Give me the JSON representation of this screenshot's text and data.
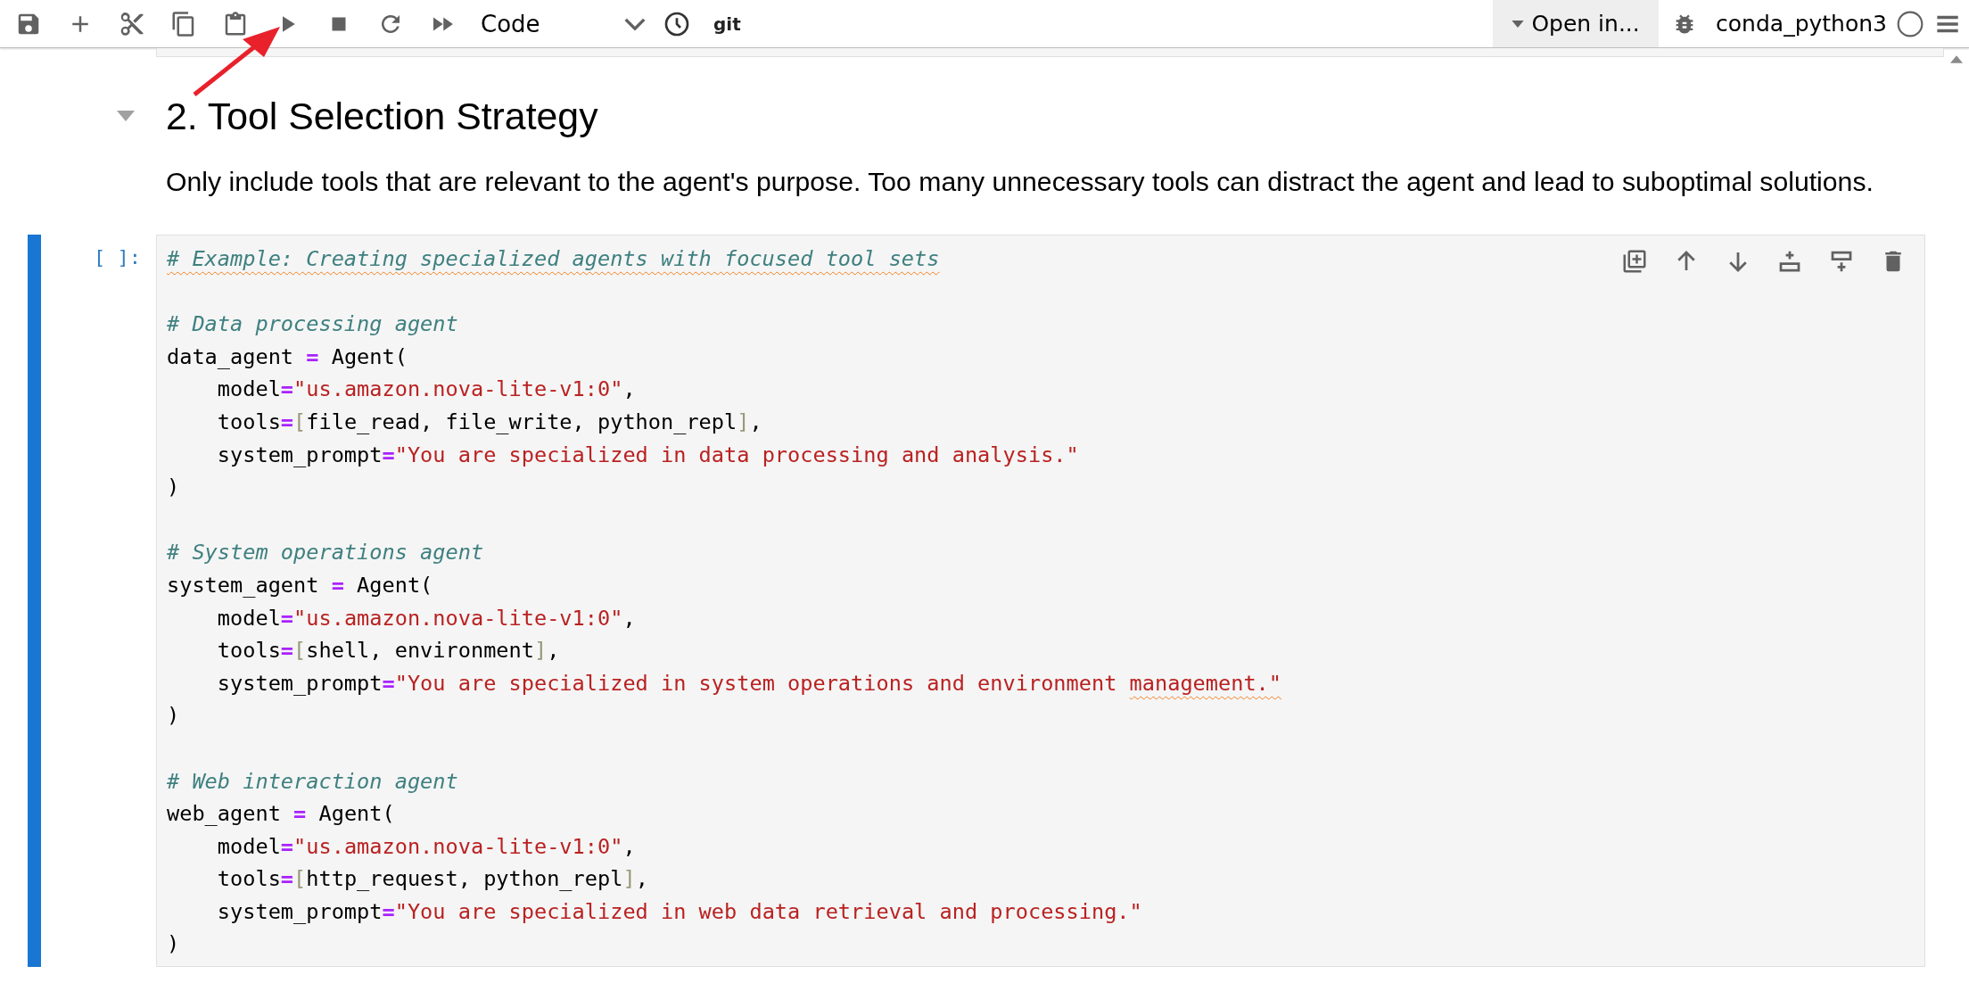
{
  "toolbar": {
    "cell_type": "Code",
    "git": "git",
    "open_in": "Open in...",
    "kernel": "conda_python3"
  },
  "section": {
    "expanded": true,
    "heading": "2. Tool Selection Strategy",
    "text": "Only include tools that are relevant to the agent's purpose. Too many unnecessary tools can distract the agent and lead to suboptimal solutions."
  },
  "cell": {
    "prompt": "[ ]:",
    "selected": true,
    "blocks": [
      {
        "lines": [
          {
            "tokens": [
              {
                "kind": "comment",
                "text": "# Example: Creating specialized agents with focused tool sets",
                "spellcheck": true
              }
            ]
          }
        ]
      },
      {
        "lines": [
          {
            "tokens": [
              {
                "kind": "comment",
                "text": "# Data processing agent"
              }
            ]
          },
          {
            "tokens": [
              {
                "kind": "plain",
                "text": "data_agent "
              },
              {
                "kind": "op",
                "text": "="
              },
              {
                "kind": "plain",
                "text": " Agent("
              }
            ]
          },
          {
            "tokens": [
              {
                "kind": "plain",
                "text": "    model"
              },
              {
                "kind": "op",
                "text": "="
              },
              {
                "kind": "string",
                "text": "\"us.amazon.nova-lite-v1:0\""
              },
              {
                "kind": "plain",
                "text": ","
              }
            ]
          },
          {
            "tokens": [
              {
                "kind": "plain",
                "text": "    tools"
              },
              {
                "kind": "op",
                "text": "="
              },
              {
                "kind": "bracket",
                "text": "["
              },
              {
                "kind": "plain",
                "text": "file_read, file_write, python_repl"
              },
              {
                "kind": "bracket",
                "text": "]"
              },
              {
                "kind": "plain",
                "text": ","
              }
            ]
          },
          {
            "tokens": [
              {
                "kind": "plain",
                "text": "    system_prompt"
              },
              {
                "kind": "op",
                "text": "="
              },
              {
                "kind": "string",
                "text": "\"You are specialized in data processing and analysis.\""
              }
            ]
          },
          {
            "tokens": [
              {
                "kind": "plain",
                "text": ")"
              }
            ]
          }
        ]
      },
      {
        "lines": [
          {
            "tokens": [
              {
                "kind": "comment",
                "text": "# System operations agent"
              }
            ]
          },
          {
            "tokens": [
              {
                "kind": "plain",
                "text": "system_agent "
              },
              {
                "kind": "op",
                "text": "="
              },
              {
                "kind": "plain",
                "text": " Agent("
              }
            ]
          },
          {
            "tokens": [
              {
                "kind": "plain",
                "text": "    model"
              },
              {
                "kind": "op",
                "text": "="
              },
              {
                "kind": "string",
                "text": "\"us.amazon.nova-lite-v1:0\""
              },
              {
                "kind": "plain",
                "text": ","
              }
            ]
          },
          {
            "tokens": [
              {
                "kind": "plain",
                "text": "    tools"
              },
              {
                "kind": "op",
                "text": "="
              },
              {
                "kind": "bracket",
                "text": "["
              },
              {
                "kind": "plain",
                "text": "shell, environment"
              },
              {
                "kind": "bracket",
                "text": "]"
              },
              {
                "kind": "plain",
                "text": ","
              }
            ]
          },
          {
            "tokens": [
              {
                "kind": "plain",
                "text": "    system_prompt"
              },
              {
                "kind": "op",
                "text": "="
              },
              {
                "kind": "string",
                "text": "\"You are specialized in system operations and environment "
              },
              {
                "kind": "string",
                "text": "management.\"",
                "spellcheck": true
              }
            ]
          },
          {
            "tokens": [
              {
                "kind": "plain",
                "text": ")"
              }
            ]
          }
        ]
      },
      {
        "lines": [
          {
            "tokens": [
              {
                "kind": "comment",
                "text": "# Web interaction agent"
              }
            ]
          },
          {
            "tokens": [
              {
                "kind": "plain",
                "text": "web_agent "
              },
              {
                "kind": "op",
                "text": "="
              },
              {
                "kind": "plain",
                "text": " Agent("
              }
            ]
          },
          {
            "tokens": [
              {
                "kind": "plain",
                "text": "    model"
              },
              {
                "kind": "op",
                "text": "="
              },
              {
                "kind": "string",
                "text": "\"us.amazon.nova-lite-v1:0\""
              },
              {
                "kind": "plain",
                "text": ","
              }
            ]
          },
          {
            "tokens": [
              {
                "kind": "plain",
                "text": "    tools"
              },
              {
                "kind": "op",
                "text": "="
              },
              {
                "kind": "bracket",
                "text": "["
              },
              {
                "kind": "plain",
                "text": "http_request, python_repl"
              },
              {
                "kind": "bracket",
                "text": "]"
              },
              {
                "kind": "plain",
                "text": ","
              }
            ]
          },
          {
            "tokens": [
              {
                "kind": "plain",
                "text": "    system_prompt"
              },
              {
                "kind": "op",
                "text": "="
              },
              {
                "kind": "string",
                "text": "\"You are specialized in web data retrieval and processing.\""
              }
            ]
          },
          {
            "tokens": [
              {
                "kind": "plain",
                "text": ")"
              }
            ]
          }
        ]
      }
    ]
  }
}
